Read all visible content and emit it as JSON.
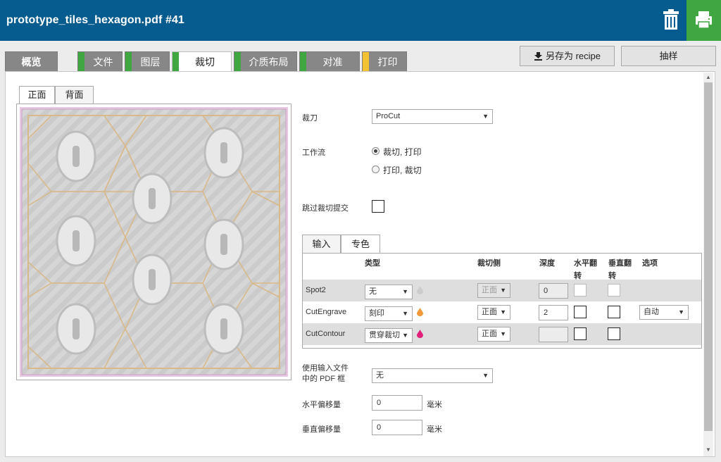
{
  "header": {
    "title": "prototype_tiles_hexagon.pdf #41"
  },
  "tabs": [
    {
      "label": "概览"
    },
    {
      "label": "文件"
    },
    {
      "label": "图层"
    },
    {
      "label": "裁切"
    },
    {
      "label": "介质布局"
    },
    {
      "label": "对准"
    },
    {
      "label": "打印"
    }
  ],
  "buttons": {
    "save_recipe": "另存为 recipe",
    "sample": "抽样"
  },
  "side_tabs": {
    "front": "正面",
    "back": "背面"
  },
  "form": {
    "cutter_label": "裁刀",
    "cutter_value": "ProCut",
    "workflow_label": "工作流",
    "workflow_options": [
      "裁切, 打印",
      "打印, 裁切"
    ],
    "skip_label": "跳过裁切提交",
    "pdfbox_label_1": "使用输入文件",
    "pdfbox_label_2": "中的 PDF 框",
    "pdfbox_value": "无",
    "hoffset_label": "水平偏移量",
    "hoffset_value": "0",
    "voffset_label": "垂直偏移量",
    "voffset_value": "0",
    "unit": "毫米"
  },
  "color_tabs": {
    "input": "输入",
    "spot": "专色"
  },
  "table": {
    "headers": {
      "type": "类型",
      "side": "裁切侧",
      "depth": "深度",
      "hflip_1": "水平翻",
      "hflip_2": "转",
      "vflip_1": "垂直翻",
      "vflip_2": "转",
      "options": "选项"
    },
    "rows": [
      {
        "name": "Spot2",
        "type": "无",
        "side": "正面",
        "depth": "0",
        "drop_color": "#cccccc"
      },
      {
        "name": "CutEngrave",
        "type": "刻印",
        "side": "正面",
        "depth": "2",
        "option": "自动",
        "drop_color": "#f0983a"
      },
      {
        "name": "CutContour",
        "type": "贯穿裁切",
        "side": "正面",
        "depth": "",
        "drop_color": "#e0207a"
      }
    ]
  },
  "colors": {
    "header": "#075c8f",
    "green": "#3fa642",
    "yellow": "#f2c233"
  }
}
